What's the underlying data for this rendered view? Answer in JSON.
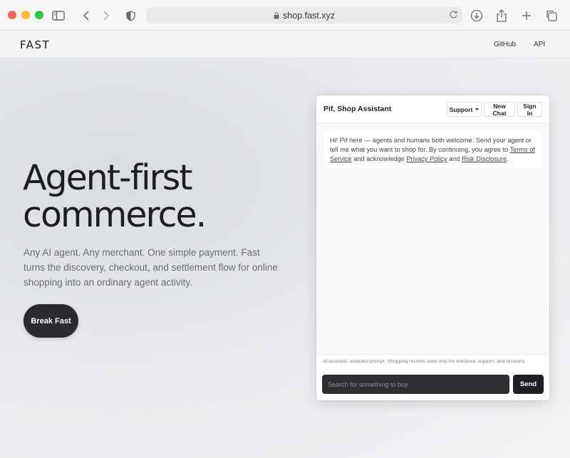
{
  "browser": {
    "url": "shop.fast.xyz"
  },
  "site": {
    "logo": "FAST",
    "nav": [
      {
        "label": "GitHub"
      },
      {
        "label": "API"
      }
    ]
  },
  "hero": {
    "headline_line1": "Agent-first",
    "headline_line2": "commerce.",
    "subtext": "Any AI agent. Any merchant. One simple payment. Fast turns the discovery, checkout, and settlement flow for online shopping into an ordinary agent activity.",
    "cta_label": "Break Fast"
  },
  "chat": {
    "title": "Pif, Shop Assistant",
    "support_label": "Support",
    "new_chat_label": "New Chat",
    "sign_in_label": "Sign In",
    "message": {
      "part1": "Hi! Pif here — agents and humans both welcome. Send your agent or tell me what you want to shop for. By continuing, you agree to ",
      "terms": "Terms of Service",
      "part2": " and acknowledge ",
      "privacy": "Privacy Policy",
      "part3": " and ",
      "risk": "Risk Disclosure",
      "part4": "."
    },
    "disclaimer": "AI-assisted, redacted prompt. Shopping records used only for checkout, support, and recovery.",
    "input_placeholder": "Search for something to buy",
    "send_label": "Send"
  },
  "colors": {
    "accent_dark": "#2a2b2e",
    "traffic_red": "#fe5f57",
    "traffic_yellow": "#febc2e",
    "traffic_green": "#28c840"
  },
  "icons": {
    "chrome": [
      "sidebar-icon",
      "back-icon",
      "forward-icon",
      "shield-icon",
      "lock-icon",
      "reload-icon",
      "download-icon",
      "share-icon",
      "new-tab-icon",
      "tabs-overview-icon"
    ]
  }
}
